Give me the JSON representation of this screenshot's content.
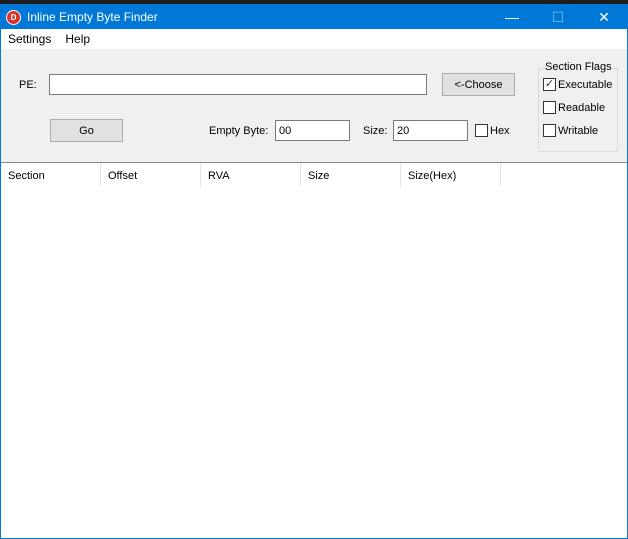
{
  "window": {
    "title": "Inline Empty Byte Finder",
    "icon": "app-logo-icon",
    "minimize": "—",
    "maximize": "☐",
    "close": "✕"
  },
  "menu": [
    "Settings",
    "Help"
  ],
  "form": {
    "pe_label": "PE:",
    "pe_value": "",
    "choose_label": "<-Choose",
    "go_label": "Go",
    "empty_byte_label": "Empty Byte:",
    "empty_byte_value": "00",
    "size_label": "Size:",
    "size_value": "20",
    "hex_label": "Hex",
    "hex_checked": false
  },
  "section_flags": {
    "title": "Section Flags",
    "executable": "Executable",
    "executable_checked": true,
    "readable": "Readable",
    "readable_checked": false,
    "writable": "Writable",
    "writable_checked": false
  },
  "columns": [
    "Section",
    "Offset",
    "RVA",
    "Size",
    "Size(Hex)"
  ]
}
